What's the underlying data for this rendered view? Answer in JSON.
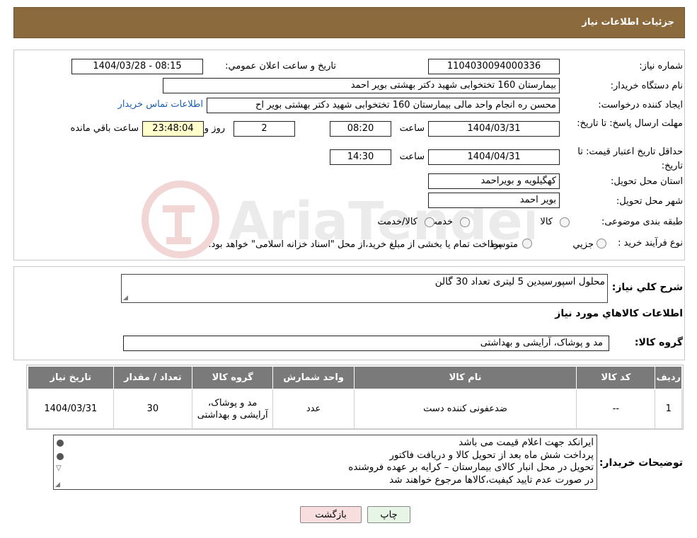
{
  "header": {
    "title": "جزئیات اطلاعات نیاز"
  },
  "watermark": {
    "text": "AriaTender.neT"
  },
  "form": {
    "need_number_label": "شماره نیاز:",
    "need_number": "1104030094000336",
    "announce_label": "تاریخ و ساعت اعلان عمومي:",
    "announce_value": "1404/03/28 - 08:15",
    "buyer_org_label": "نام دستگاه خریدار:",
    "buyer_org": "بیمارستان 160 تختخوابی شهید دکتر بهشتی بویر احمد",
    "creator_label": "ایجاد کننده درخواست:",
    "creator": "محسن ره انجام واحد مالی بیمارستان 160 تختخوابی شهید دکتر بهشتی بویر اح",
    "contact_link": "اطلاعات تماس خریدار",
    "deadline_label": "مهلت ارسال پاسخ: تا تاریخ:",
    "deadline_date": "1404/03/31",
    "time_label": "ساعت",
    "deadline_time": "08:20",
    "days_value": "2",
    "days_label": "روز و",
    "remaining_time": "23:48:04",
    "remaining_label": "ساعت باقي مانده",
    "validity_label": "حداقل تاریخ اعتبار قیمت: تا تاریخ:",
    "validity_date": "1404/04/31",
    "validity_time": "14:30",
    "province_label": "استان محل تحویل:",
    "province": "کهگیلویه و بویراحمد",
    "city_label": "شهر محل تحویل:",
    "city": "بویر احمد",
    "category_label": "طبقه بندی موضوعی:",
    "category_options": [
      "کالا",
      "خدمت",
      "کالا/خدمت"
    ],
    "process_label": "نوع فرآیند خرید :",
    "process_options": [
      "جزیي",
      "متوسط"
    ],
    "process_note": "پرداخت تمام یا بخشی از مبلغ خرید،از محل \"اسناد خزانه اسلامی\" خواهد بود."
  },
  "summary": {
    "label": "شرح کلي نیاز:",
    "value": "محلول اسپورسیدین 5 لیتری تعداد 30 گالن",
    "goods_info_title": "اطلاعات کالاهاي مورد نیاز",
    "group_label": "گروه کالا:",
    "group_value": "مد و پوشاک، آرایشی و بهداشتی"
  },
  "table": {
    "headers": [
      "ردیف",
      "کد کالا",
      "نام کالا",
      "واحد شمارش",
      "گروه کالا",
      "تعداد / مقدار",
      "تاریخ نیاز"
    ],
    "rows": [
      [
        "1",
        "--",
        "ضدعفونی کننده دست",
        "عدد",
        "مد و پوشاک، آرایشی و بهداشتی",
        "30",
        "1404/03/31"
      ]
    ]
  },
  "notes": {
    "label": "توضیحات خریدار:",
    "lines": [
      "ایرانکد جهت اعلام قیمت می باشد",
      "پرداخت شش ماه بعد از تحویل کالا و دریافت فاکتور",
      "تحویل در محل انبار کالای بیمارستان – کرایه بر عهده فروشنده",
      "در صورت عدم تایید کیفیت،کالاها مرجوع خواهند شد"
    ]
  },
  "buttons": {
    "print": "چاپ",
    "back": "بازگشت"
  },
  "colors": {
    "header_bg": "#8b6a3e",
    "table_header_bg": "#7a7a7a",
    "countdown_bg": "#ffffcc",
    "back_btn_bg": "#f8dede",
    "print_btn_bg": "#e6f5e6"
  }
}
